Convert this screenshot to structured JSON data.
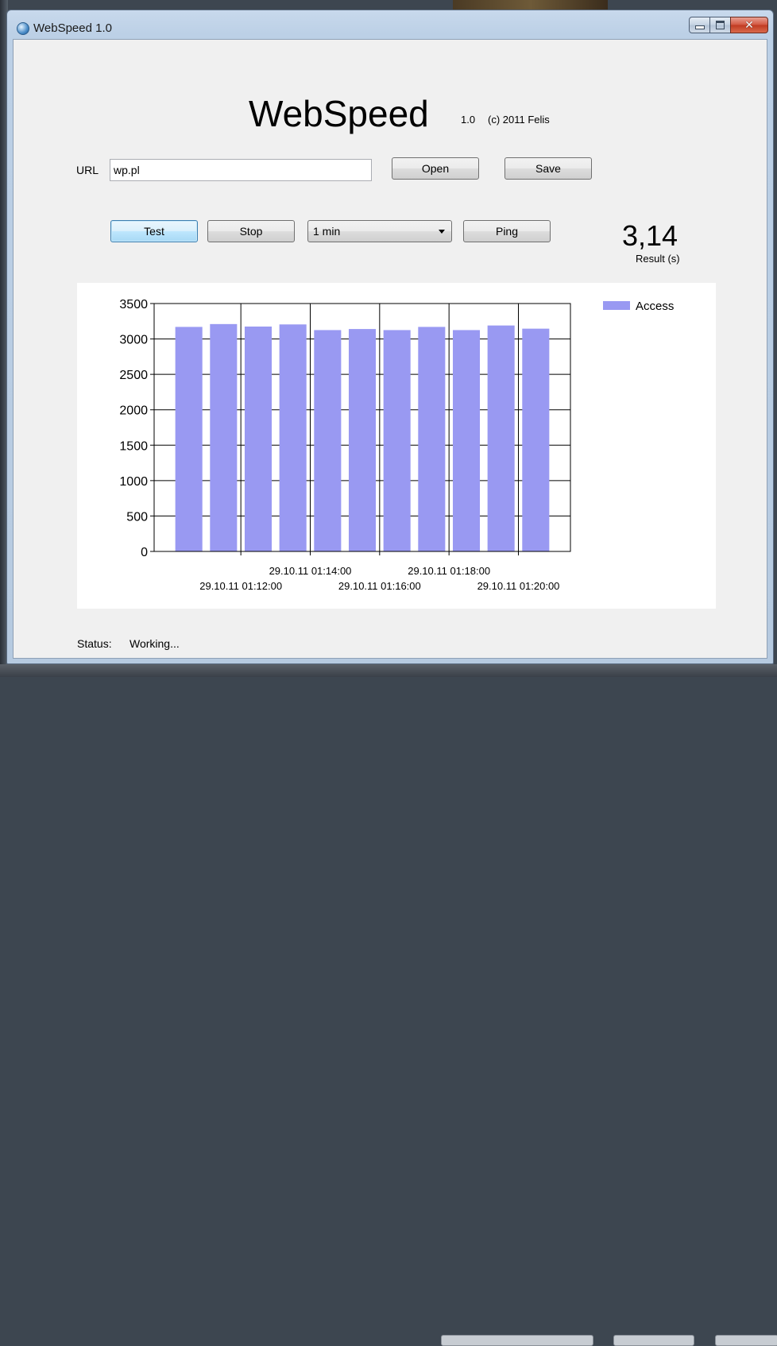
{
  "window": {
    "title": "WebSpeed 1.0"
  },
  "header": {
    "app_name": "WebSpeed",
    "version": "1.0",
    "copyright": "(c) 2011 Felis"
  },
  "url_row": {
    "label": "URL",
    "value": "wp.pl",
    "open_label": "Open",
    "save_label": "Save"
  },
  "controls": {
    "test_label": "Test",
    "stop_label": "Stop",
    "interval_selected": "1 min",
    "ping_label": "Ping"
  },
  "result": {
    "value": "3,14",
    "label": "Result (s)"
  },
  "status": {
    "label": "Status:",
    "text": "Working..."
  },
  "colors": {
    "bar": "#9999f2",
    "window_frame": "#bcd0e6",
    "client": "#f0f0f0"
  },
  "chart_data": {
    "type": "bar",
    "series": [
      {
        "name": "Access",
        "values": [
          3170,
          3210,
          3175,
          3205,
          3125,
          3140,
          3125,
          3170,
          3125,
          3190,
          3145
        ]
      }
    ],
    "ylim": [
      0,
      3500
    ],
    "yticks": [
      0,
      500,
      1000,
      1500,
      2000,
      2500,
      3000,
      3500
    ],
    "xtick_labels": [
      {
        "text": "29.10.11 01:12:00",
        "between": [
          1,
          2
        ],
        "row": 2
      },
      {
        "text": "29.10.11 01:14:00",
        "between": [
          3,
          4
        ],
        "row": 1
      },
      {
        "text": "29.10.11 01:16:00",
        "between": [
          5,
          6
        ],
        "row": 2
      },
      {
        "text": "29.10.11 01:18:00",
        "between": [
          7,
          8
        ],
        "row": 1
      },
      {
        "text": "29.10.11 01:20:00",
        "between": [
          9,
          10
        ],
        "row": 2
      }
    ],
    "grid": true,
    "legend": "top-right"
  }
}
